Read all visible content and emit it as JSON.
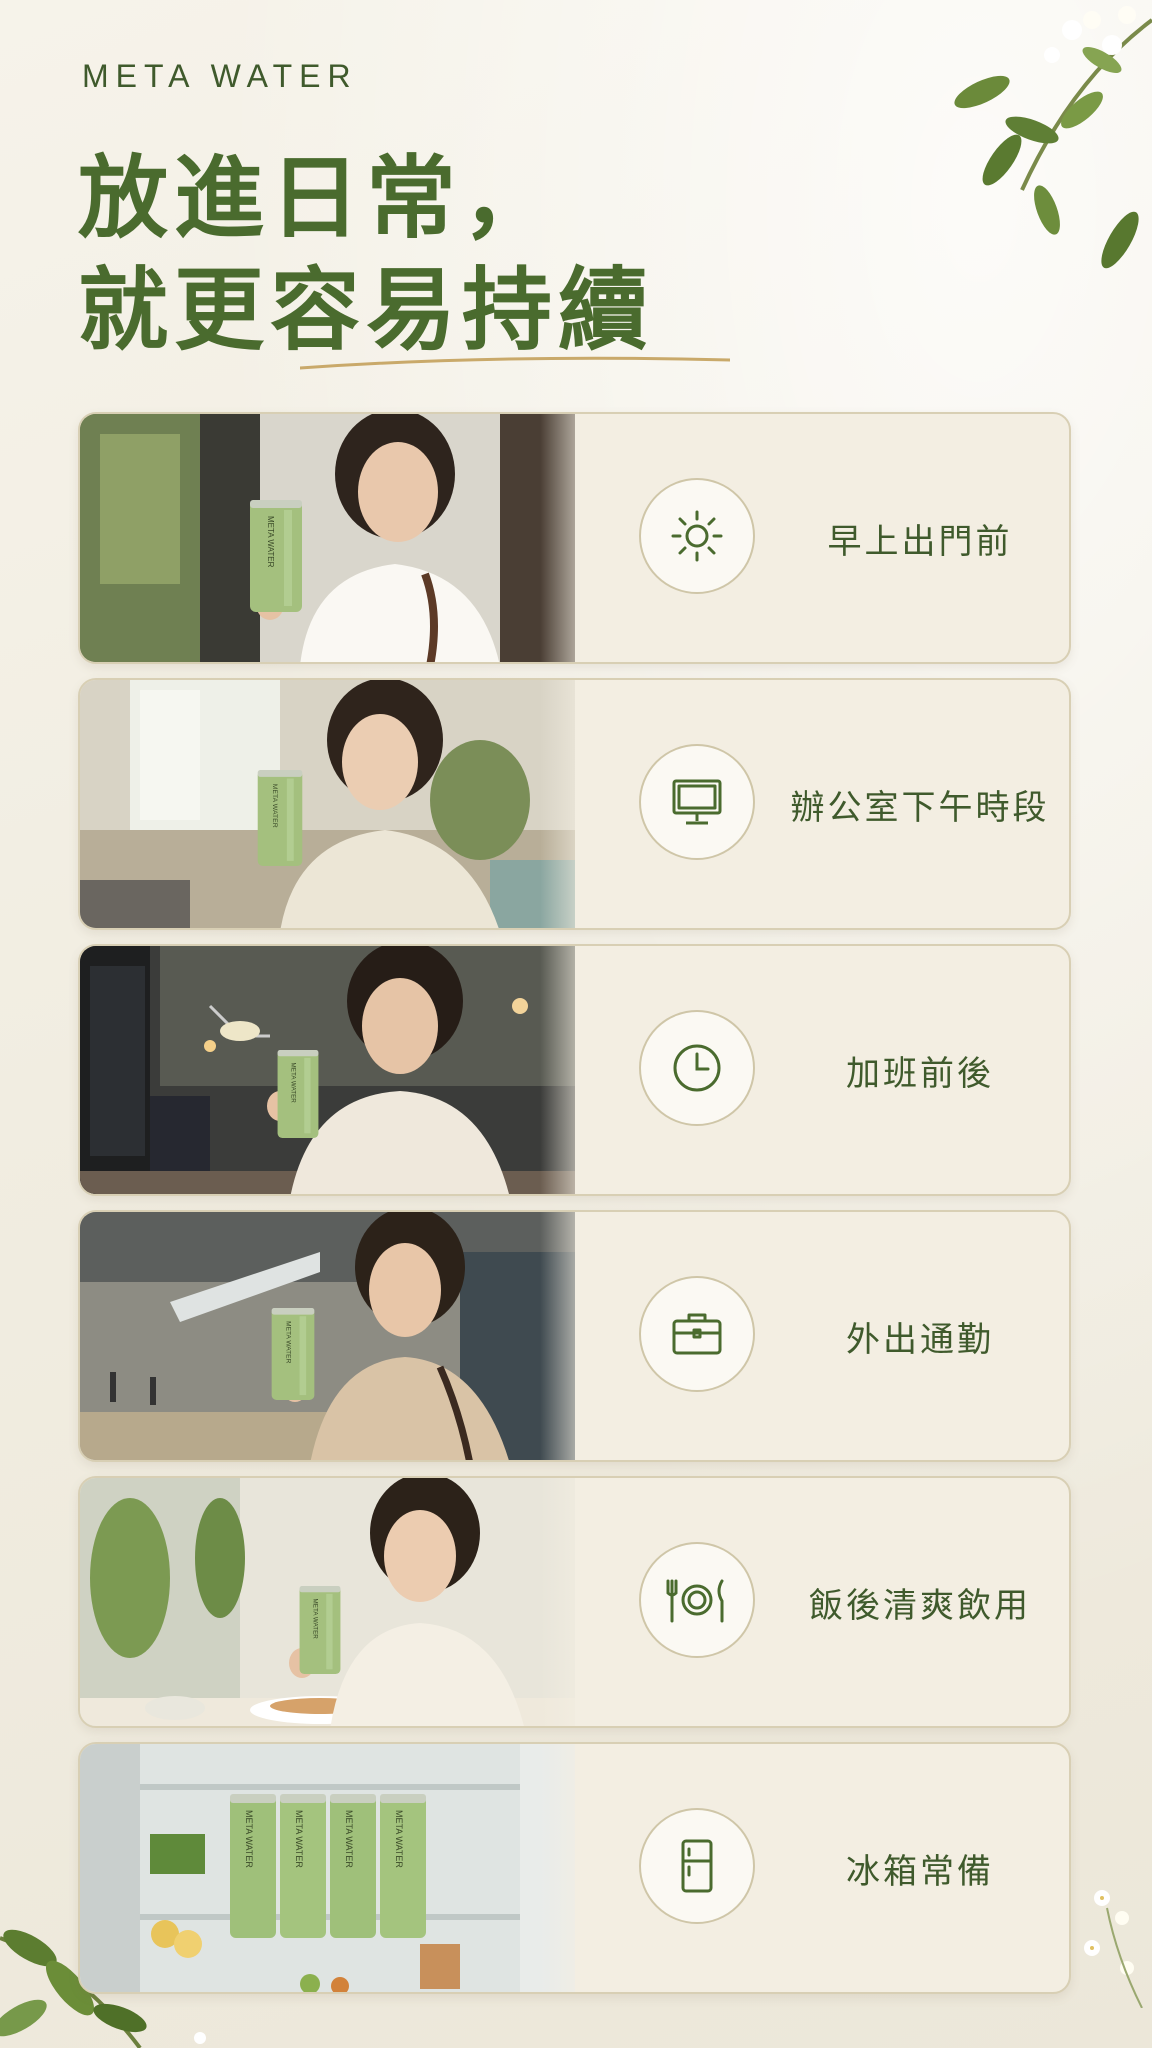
{
  "brand": "META WATER",
  "headline": {
    "line1": "放進日常，",
    "line2": "就更容易持續"
  },
  "can_text": "META WATER",
  "moments": [
    {
      "label": "早上出門前",
      "icon": "sun-icon",
      "scene": "morning-doorway"
    },
    {
      "label": "辦公室下午時段",
      "icon": "monitor-icon",
      "scene": "office-afternoon"
    },
    {
      "label": "加班前後",
      "icon": "clock-icon",
      "scene": "overtime-desk"
    },
    {
      "label": "外出通勤",
      "icon": "briefcase-icon",
      "scene": "commute-station"
    },
    {
      "label": "飯後清爽飲用",
      "icon": "fork-plate-knife-icon",
      "scene": "after-meal"
    },
    {
      "label": "冰箱常備",
      "icon": "refrigerator-icon",
      "scene": "fridge-stock"
    }
  ],
  "colors": {
    "accent": "#4a6b2e",
    "text": "#3f5a2c",
    "card_bg": "#f3eee2",
    "can_green": "#9fc07a"
  }
}
